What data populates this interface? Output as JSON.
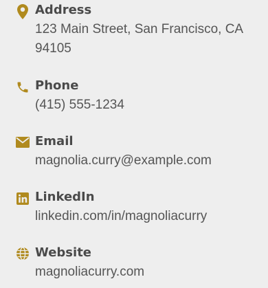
{
  "accent_color": "#b08a1e",
  "contacts": {
    "address": {
      "icon": "map-marker-icon",
      "label": "Address",
      "value": "123 Main Street, San Francisco, CA 94105"
    },
    "phone": {
      "icon": "phone-icon",
      "label": "Phone",
      "value": "(415) 555-1234"
    },
    "email": {
      "icon": "envelope-icon",
      "label": "Email",
      "value": "magnolia.curry@example.com"
    },
    "linkedin": {
      "icon": "linkedin-icon",
      "label": "LinkedIn",
      "value": "linkedin.com/in/magnoliacurry"
    },
    "website": {
      "icon": "globe-icon",
      "label": "Website",
      "value": "magnoliacurry.com"
    }
  }
}
